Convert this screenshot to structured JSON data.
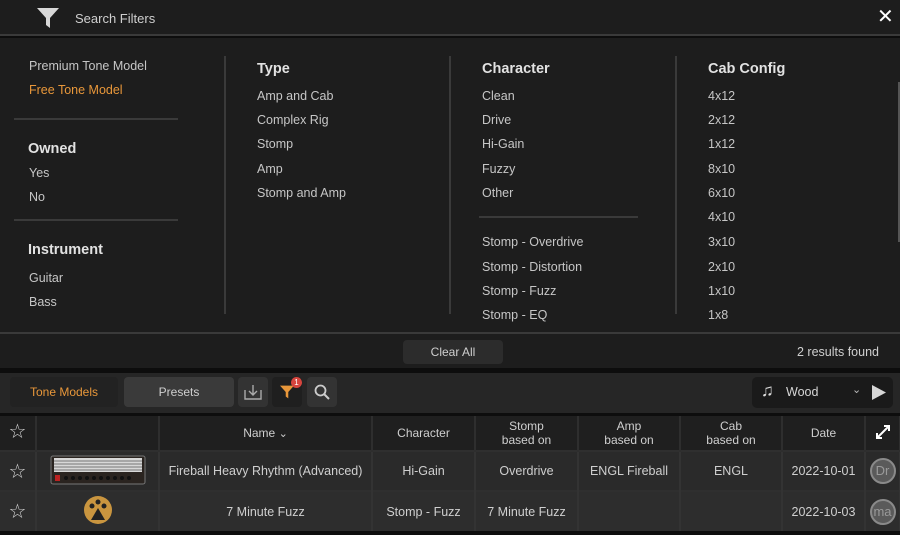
{
  "header": {
    "title": "Search Filters",
    "filter_icon": "funnel-icon",
    "close_icon": "close-icon"
  },
  "filters": {
    "model_type": {
      "items": [
        {
          "label": "Premium Tone Model",
          "selected": false
        },
        {
          "label": "Free Tone Model",
          "selected": true
        }
      ]
    },
    "owned": {
      "title": "Owned",
      "items": [
        "Yes",
        "No"
      ]
    },
    "instrument": {
      "title": "Instrument",
      "items": [
        "Guitar",
        "Bass"
      ]
    },
    "type": {
      "title": "Type",
      "items": [
        "Amp and Cab",
        "Complex Rig",
        "Stomp",
        "Amp",
        "Stomp and Amp"
      ]
    },
    "character": {
      "title": "Character",
      "items": [
        "Clean",
        "Drive",
        "Hi-Gain",
        "Fuzzy",
        "Other"
      ],
      "stomp_items": [
        "Stomp - Overdrive",
        "Stomp - Distortion",
        "Stomp - Fuzz",
        "Stomp - EQ"
      ]
    },
    "cab_config": {
      "title": "Cab Config",
      "items": [
        "4x12",
        "2x12",
        "1x12",
        "8x10",
        "6x10",
        "4x10",
        "3x10",
        "2x10",
        "1x10",
        "1x8"
      ]
    }
  },
  "footer": {
    "clear_all": "Clear All",
    "results": "2 results found"
  },
  "toolbar": {
    "tabs": [
      {
        "label": "Tone Models",
        "active": true
      },
      {
        "label": "Presets",
        "active": false
      }
    ],
    "filter_badge": "1",
    "preview_source": "Wood",
    "accent_color": "#e8973a"
  },
  "table": {
    "columns": [
      "Name",
      "Character",
      "Stomp\nbased on",
      "Amp\nbased on",
      "Cab\nbased on",
      "Date"
    ],
    "col_labels": {
      "name": "Name",
      "character": "Character",
      "stomp1": "Stomp",
      "stomp2": "based on",
      "amp1": "Amp",
      "amp2": "based on",
      "cab1": "Cab",
      "cab2": "based on",
      "date": "Date"
    },
    "rows": [
      {
        "name": "Fireball Heavy Rhythm (Advanced)",
        "character": "Hi-Gain",
        "stomp": "Overdrive",
        "amp": "ENGL Fireball",
        "cab": "ENGL",
        "date": "2022-10-01",
        "avatar": "Dr"
      },
      {
        "name": "7 Minute Fuzz",
        "character": "Stomp - Fuzz",
        "stomp": "7 Minute Fuzz",
        "amp": "",
        "cab": "",
        "date": "2022-10-03",
        "avatar": "ma"
      }
    ]
  }
}
